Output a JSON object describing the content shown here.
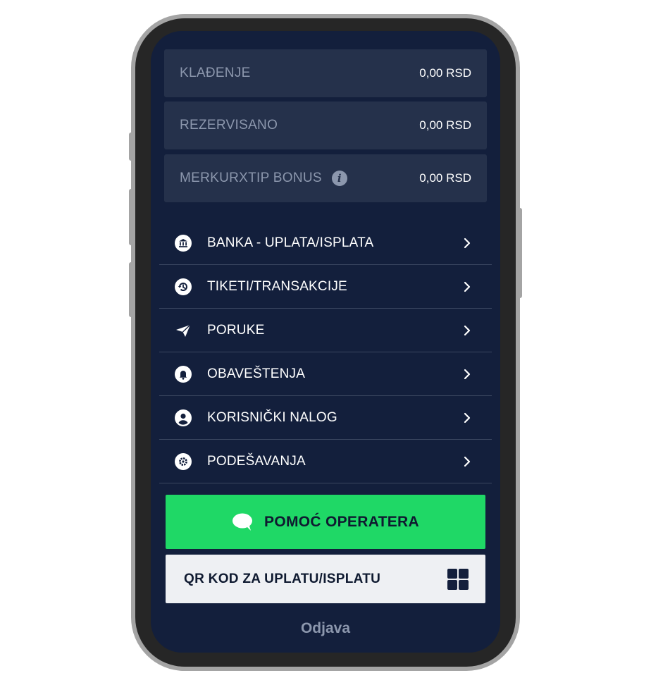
{
  "balances": [
    {
      "label": "KLAĐENJE",
      "value": "0,00 RSD"
    },
    {
      "label": "REZERVISANO",
      "value": "0,00 RSD"
    },
    {
      "label": "MERKURXTIP BONUS",
      "value": "0,00 RSD",
      "info_icon": "i"
    }
  ],
  "menu": [
    {
      "label": "BANKA - UPLATA/ISPLATA",
      "icon": "bank-icon"
    },
    {
      "label": "TIKETI/TRANSAKCIJE",
      "icon": "history-icon"
    },
    {
      "label": "PORUKE",
      "icon": "paper-plane-icon"
    },
    {
      "label": "OBAVEŠTENJA",
      "icon": "bell-icon"
    },
    {
      "label": "KORISNIČKI NALOG",
      "icon": "user-circle-icon"
    },
    {
      "label": "PODEŠAVANJA",
      "icon": "gear-icon"
    }
  ],
  "operator_button": {
    "label": "POMOĆ OPERATERA",
    "icon": "chat-bubble-icon"
  },
  "qr_button": {
    "label": "QR KOD ZA UPLATU/ISPLATU",
    "icon": "qr-grid-icon"
  },
  "logout": {
    "label": "Odjava"
  },
  "colors": {
    "screen_bg": "#131f3c",
    "row_bg": "#25314b",
    "accent_green": "#1fd866",
    "muted_text": "#8c97ad",
    "light_button": "#eef0f3"
  }
}
